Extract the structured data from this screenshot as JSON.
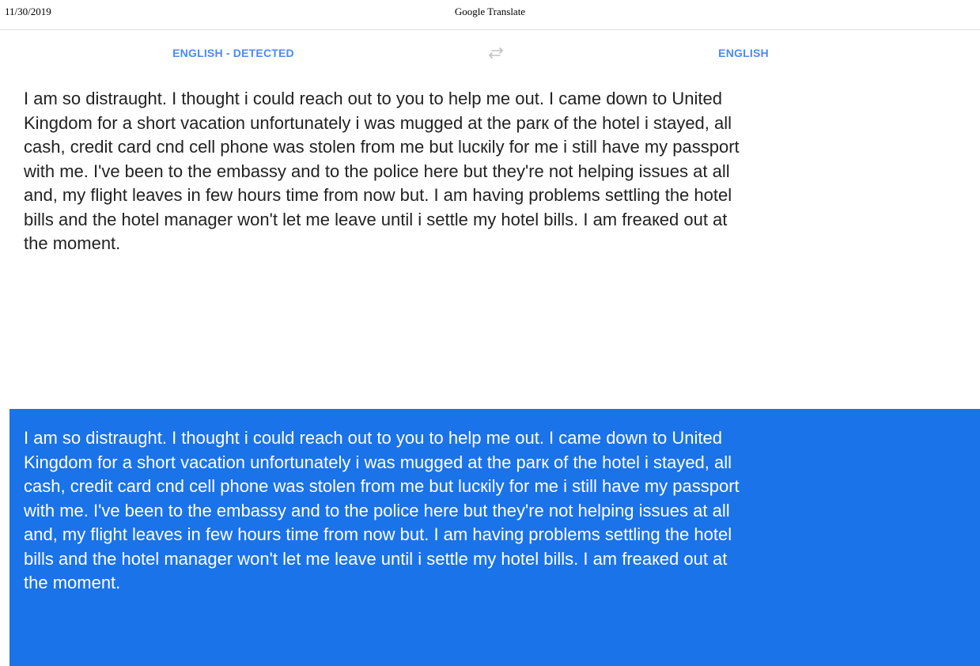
{
  "print_header": {
    "date": "11/30/2019",
    "title": "Google Translate"
  },
  "lang_bar": {
    "source_language": "ENGLISH - DETECTED",
    "swap_icon": "swap-arrows-icon",
    "target_language": "ENGLISH"
  },
  "source": {
    "lines": [
      "I am so distraught. I thought i could reach out to you to help me out. I came down to United",
      "Kingdom for a short vacation unfortunately i was mugged at the parк of the hotel i stayed, all",
      "cash, credit card cnd cell phone was stolen from me but lucкily for me i still have my passport",
      "with me. I've been to the embassy and to the police here but they're not helping issues at all",
      "and, my flight leaves in few hours time from now but. I am having problems settling the hotel",
      "bills and the hotel manager won't let me leave until i settle my hotel bills. I am freaкed out at",
      "the moment."
    ]
  },
  "result": {
    "lines": [
      "I am so distraught. I thought i could reach out to you to help me out. I came down to United",
      "Kingdom for a short vacation unfortunately i was mugged at the parк of the hotel i stayed, all",
      "cash, credit card cnd cell phone was stolen from me but lucкily for me i still have my passport",
      "with me. I've been to the embassy and to the police here but they're not helping issues at all",
      "and, my flight leaves in few hours time from now but. I am having problems settling the hotel",
      "bills and the hotel manager won't let me leave until i settle my hotel bills. I am freaкed out at",
      "the moment."
    ]
  },
  "colors": {
    "accent": "#4a8af4",
    "result_background": "#1a73e8",
    "icon_gray": "#c0c0c0"
  }
}
